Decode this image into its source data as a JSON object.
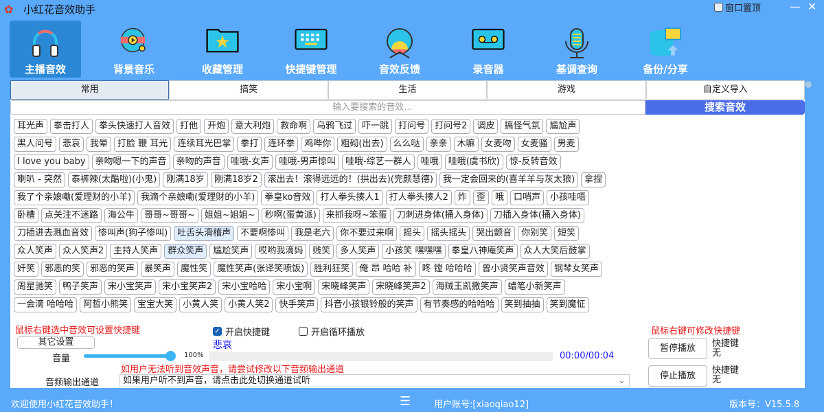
{
  "window": {
    "title": "小红花音效助手",
    "pin_label": "窗口置顶",
    "minimize": "—",
    "close": "✕"
  },
  "nav": [
    {
      "label": "主播音效",
      "icon": "headphones-icon",
      "selected": true
    },
    {
      "label": "背景音乐",
      "icon": "music-disc-icon"
    },
    {
      "label": "收藏管理",
      "icon": "star-folder-icon"
    },
    {
      "label": "快捷键管理",
      "icon": "keyboard-icon"
    },
    {
      "label": "音效反馈",
      "icon": "feedback-icon"
    },
    {
      "label": "录音器",
      "icon": "cassette-icon"
    },
    {
      "label": "基调查询",
      "icon": "microphone-icon"
    },
    {
      "label": "备份/分享",
      "icon": "database-upload-icon"
    }
  ],
  "tabs": [
    "常用",
    "搞笑",
    "生活",
    "游戏",
    "自定义导入"
  ],
  "search": {
    "placeholder": "输入要搜索的音效...",
    "button": "搜索音效"
  },
  "sounds": {
    "highlighted": [
      "吐舌头滑稽声",
      "群众笑声"
    ],
    "rows": [
      [
        "耳光声",
        "拳击打人",
        "拳头快速打人音效",
        "打他",
        "开炮",
        "意大利炮",
        "救命啊",
        "乌鸦飞过",
        "吓一跳",
        "打问号",
        "打问号2",
        "调皮",
        "搞怪气氛",
        "尴尬声"
      ],
      [
        "黑人问号",
        "悲哀",
        "我晕",
        "打脸 鞭 耳光",
        "连续耳光巴掌",
        "拳打",
        "连环拳",
        "鸡哔你",
        "粗砌(出去)",
        "么么哒",
        "亲亲",
        "木嘛",
        "女麦吻",
        "女麦骚",
        "男麦"
      ],
      [
        "I love you baby",
        "亲吻嗯一下的声音",
        "亲吻的声音",
        "哇哦-女声",
        "哇哦-男声惊叫",
        "哇哦-综艺一群人",
        "哇哦",
        "哇哦(虞书欣)",
        "惊-反转音效"
      ],
      [
        "喇叭 - 突然",
        "泰裤辣(太酷啦)(小鬼)",
        "刚满18岁",
        "刚满18岁2",
        "滚出去！滚得远远的！(拱出去)(完颜慧德)",
        "我一定会回来的(喜羊羊与灰太狼)",
        "拿捏"
      ],
      [
        "我了个亲娘嘞(爱理财的小羊)",
        "我滴个亲娘嘞(爱理财的小羊)",
        "拳皇ko音效",
        "打人拳头揍人1",
        "打人拳头揍人2",
        "炸",
        "歪",
        "哦",
        "口哨声",
        "小孩哇唔"
      ],
      [
        "卧槽",
        "点关注不迷路",
        "海公牛",
        "哥哥~哥哥~",
        "姐姐~姐姐~",
        "秒啊(蛋黄派)",
        "来抓我呀~笨蛋",
        "刀刺进身体(捅入身体)",
        "刀插入身体(捅入身体)"
      ],
      [
        "刀插进去溅血音效",
        "惨叫声(狗子惨叫)",
        "吐舌头滑稽声",
        "不要啊惨叫",
        "我是老六",
        "你不要过来啊",
        "摇头",
        "摇头摇头",
        "哭出颤音",
        "你别笑",
        "短笑"
      ],
      [
        "众人笑声",
        "众人笑声2",
        "主持人笑声",
        "群众笑声",
        "尴尬笑声",
        "哎哟我滴妈",
        "贱笑",
        "多人笑声",
        "小孩笑 嘿嘿嘿",
        "拳皇八神庵笑声",
        "众人大笑后鼓掌"
      ],
      [
        "奸笑",
        "邪恶的笑",
        "邪恶的笑声",
        "暴笑声",
        "魔性笑",
        "魔性笑声(张译笑喷饭)",
        "胜利狂笑",
        "俺 昂 哈哈 补",
        "咚 镗 哈哈哈",
        "曾小贤笑声音效",
        "钢琴女笑声"
      ],
      [
        "周星驰笑",
        "鸭子笑声",
        "宋小宝笑声",
        "宋小宝笑声2",
        "宋小宝哈哈",
        "宋小宝啊",
        "宋晓峰笑声",
        "宋晓峰笑声2",
        "海贼王凯撒笑声",
        "蜡笔小新笑声"
      ],
      [
        "一会滴 哈哈哈",
        "阿哲小熊笑",
        "宝宝大笑",
        "小黄人笑",
        "小黄人笑2",
        "快手笑声",
        "抖音小孩银铃般的笑声",
        "有节奏感的哈哈哈",
        "笑到抽抽",
        "笑到魔怔"
      ]
    ]
  },
  "controls": {
    "hint_left": "鼠标右键选中音效可设置快捷键",
    "enable_hotkey": "开启快捷键",
    "enable_hotkey_checked": true,
    "loop_play": "开启循环播放",
    "loop_play_checked": false,
    "other_settings": "其它设置",
    "current_sound": "悲哀",
    "volume_label": "音量",
    "volume_value": "100%",
    "volume_fraction": 1.0,
    "playback_progress": 0,
    "time": "00:00/00:04",
    "output_hint": "如用户无法听到音效声音，请尝试修改以下音频输出通道",
    "output_label": "音频输出通道",
    "output_value": "如果用户听不到声音，请点击此处切换通道试听",
    "hint_right": "鼠标右键可修改快捷键",
    "pause_button": "暂停播放",
    "stop_button": "停止播放",
    "hotkey_label": "快捷键",
    "hotkey_none": "无"
  },
  "status": {
    "welcome": "欢迎使用小红花音效助手！",
    "account": "用户账号:[xiaoqiao12]",
    "version": "版本号：V15.5.8"
  },
  "colors": {
    "bg": "#5aa9fb",
    "accent": "#4b6de8",
    "red": "#e41b1b",
    "blue_text": "#1a1aff"
  }
}
